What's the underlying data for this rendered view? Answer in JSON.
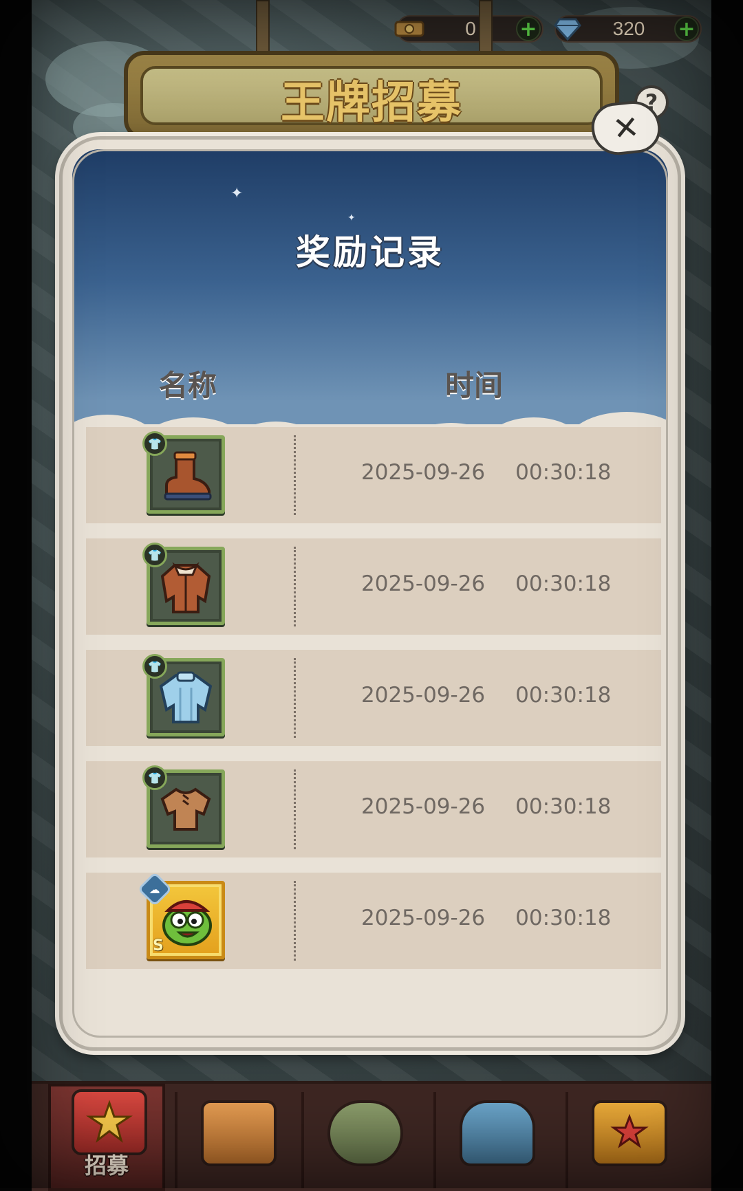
{
  "currencies": [
    {
      "icon": "ticket-icon",
      "value": "0"
    },
    {
      "icon": "diamond-icon",
      "value": "320"
    }
  ],
  "header": {
    "title": "王牌招募",
    "help_label": "?",
    "close_label": "✕"
  },
  "dialog": {
    "title": "奖励记录",
    "columns": {
      "name": "名称",
      "time": "时间"
    },
    "records": [
      {
        "item": "boot-icon",
        "date": "2025-09-26",
        "time": "00:30:18"
      },
      {
        "item": "jacket-icon",
        "date": "2025-09-26",
        "time": "00:30:18"
      },
      {
        "item": "sweater-icon",
        "date": "2025-09-26",
        "time": "00:30:18"
      },
      {
        "item": "shirt-icon",
        "date": "2025-09-26",
        "time": "00:30:18"
      },
      {
        "item": "frog-hero-icon",
        "date": "2025-09-26",
        "time": "00:30:18",
        "rank": "S"
      }
    ]
  },
  "bottom_nav": {
    "active_label": "招募",
    "items": [
      "recruit-chest-icon",
      "bag-icon",
      "machine-icon",
      "pilot-helmet-icon",
      "star-box-icon"
    ]
  },
  "colors": {
    "row": "#dccfbf",
    "frame_green": "#86a75a",
    "frame_gold": "#e3a01d",
    "plus_green": "#5fd84a"
  }
}
